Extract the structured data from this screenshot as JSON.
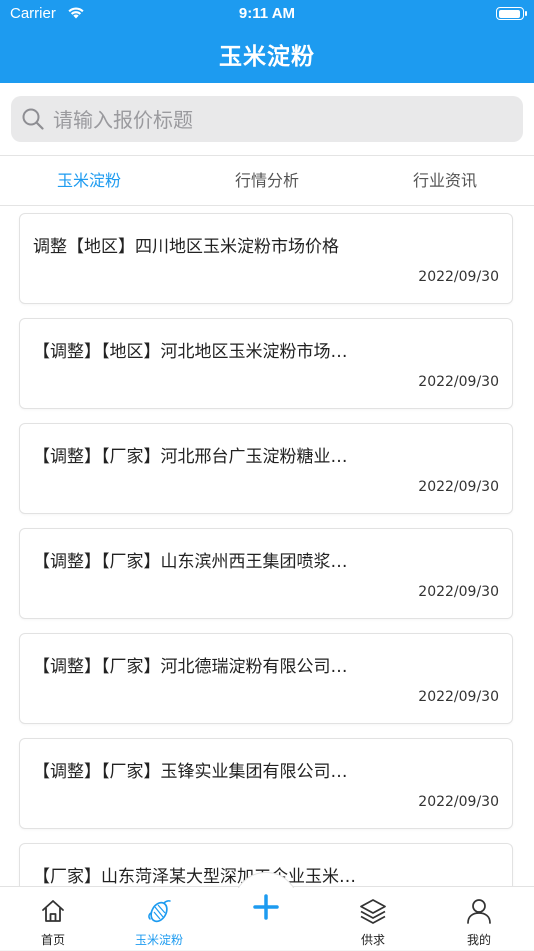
{
  "status_bar": {
    "carrier": "Carrier",
    "time": "9:11 AM"
  },
  "header": {
    "title": "玉米淀粉"
  },
  "search": {
    "placeholder": "请输入报价标题"
  },
  "tabs": [
    {
      "label": "玉米淀粉",
      "active": true
    },
    {
      "label": "行情分析",
      "active": false
    },
    {
      "label": "行业资讯",
      "active": false
    }
  ],
  "articles": [
    {
      "title": "调整【地区】四川地区玉米淀粉市场价格",
      "date": "2022/09/30"
    },
    {
      "title": "【调整】【地区】河北地区玉米淀粉市场…",
      "date": "2022/09/30"
    },
    {
      "title": "【调整】【厂家】河北邢台广玉淀粉糖业…",
      "date": "2022/09/30"
    },
    {
      "title": "【调整】【厂家】山东滨州西王集团喷浆…",
      "date": "2022/09/30"
    },
    {
      "title": "【调整】【厂家】河北德瑞淀粉有限公司…",
      "date": "2022/09/30"
    },
    {
      "title": "【调整】【厂家】玉锋实业集团有限公司…",
      "date": "2022/09/30"
    },
    {
      "title": "【厂家】山东菏泽某大型深加工企业玉米…",
      "date": ""
    }
  ],
  "tabbar": {
    "items": [
      {
        "label": "首页",
        "icon": "home-icon",
        "active": false
      },
      {
        "label": "玉米淀粉",
        "icon": "corn-icon",
        "active": true
      },
      {
        "label": "供求",
        "icon": "layers-icon",
        "active": false
      },
      {
        "label": "我的",
        "icon": "person-icon",
        "active": false
      }
    ],
    "center_button_icon": "plus-icon"
  },
  "colors": {
    "accent": "#1d9bf0",
    "background": "#f5f5f5"
  }
}
